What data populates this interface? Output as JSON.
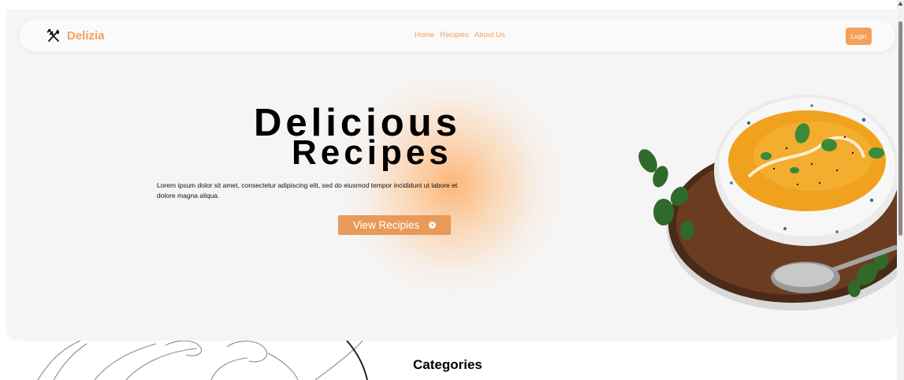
{
  "navbar": {
    "brand_name": "Delizia",
    "brand_icon": "utensils-crossed-icon",
    "links": [
      {
        "label": "Home"
      },
      {
        "label": "Recipies"
      },
      {
        "label": "About Us"
      }
    ],
    "login_label": "Login"
  },
  "hero": {
    "title_line1": "Delicious",
    "title_line2": "Recipes",
    "description": "Lorem ipsum dolor sit amet, consectetur adipiscing elit, sed do eiusmod tempor incididunt ut labore et dolore magna aliqua.",
    "cta_label": "View Recipies",
    "cta_icon": "play-circle-icon",
    "image": "soup-bowl-image"
  },
  "categories": {
    "title": "Categories"
  },
  "colors": {
    "accent": "#f4a05a",
    "button": "#e89a58",
    "hero_background": "#f5f5f5",
    "glow": "#ffac64"
  }
}
